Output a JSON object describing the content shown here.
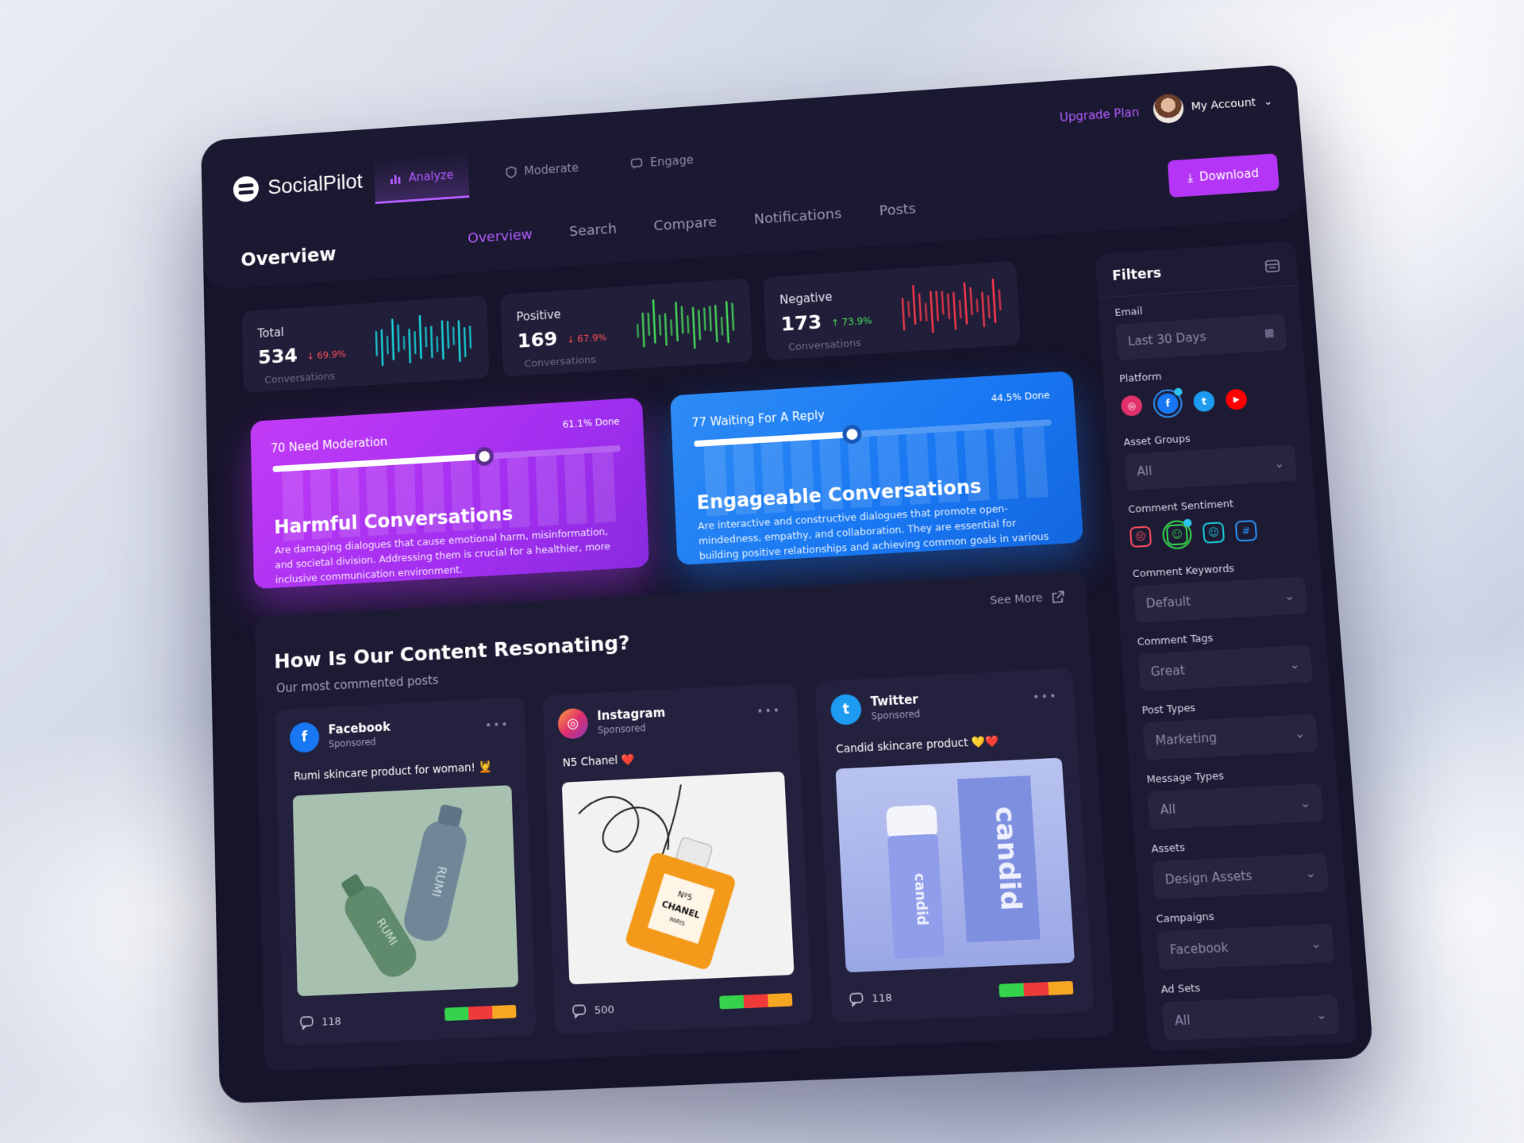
{
  "app": {
    "name": "SocialPilot"
  },
  "header": {
    "main_tabs": [
      {
        "label": "Analyze",
        "active": true
      },
      {
        "label": "Moderate",
        "active": false
      },
      {
        "label": "Engage",
        "active": false
      }
    ],
    "upgrade_label": "Upgrade Plan",
    "account_label": "My Account",
    "download_label": "Download"
  },
  "page": {
    "title": "Overview",
    "sub_tabs": [
      "Overview",
      "Search",
      "Compare",
      "Notifications",
      "Posts"
    ],
    "active_sub_tab": "Overview"
  },
  "stats": [
    {
      "label": "Total",
      "value": "534",
      "delta": "↓ 69.9%",
      "delta_color": "#ff4d5e",
      "sub": "Conversations",
      "spark_color": "#19e0e6"
    },
    {
      "label": "Positive",
      "value": "169",
      "delta": "↓ 67.9%",
      "delta_color": "#ff4d5e",
      "sub": "Conversations",
      "spark_color": "#48e05a"
    },
    {
      "label": "Negative",
      "value": "173",
      "delta": "↑ 73.9%",
      "delta_color": "#48e05a",
      "sub": "Conversations",
      "spark_color": "#ff3a4c"
    }
  ],
  "moderation": {
    "progress_label": "70 Need Moderation",
    "done_label": "61.1% Done",
    "progress": 0.611,
    "title": "Harmful Conversations",
    "description": "Are damaging dialogues that cause emotional harm, misinformation, and societal division. Addressing them is crucial for a healthier, more inclusive communication environment."
  },
  "engageable": {
    "progress_label": "77 Waiting For A Reply",
    "done_label": "44.5% Done",
    "progress": 0.445,
    "title": "Engageable Conversations",
    "description": "Are interactive and constructive dialogues that promote open-mindedness, empathy, and collaboration. They are essential for building positive relationships and achieving common goals in various contexts."
  },
  "content": {
    "title": "How Is Our Content Resonating?",
    "subtitle": "Our most commented posts",
    "see_more": "See More",
    "posts": [
      {
        "platform": "Facebook",
        "sponsored": "Sponsored",
        "caption": "Rumi skincare product for woman! 💆",
        "comments": "118",
        "color": "#1877f2",
        "glyph": "f"
      },
      {
        "platform": "Instagram",
        "sponsored": "Sponsored",
        "caption": "N5 Chanel ❤️",
        "comments": "500",
        "color": "#e1306c",
        "glyph": "◎"
      },
      {
        "platform": "Twitter",
        "sponsored": "Sponsored",
        "caption": "Candid skincare product 💛❤️",
        "comments": "118",
        "color": "#1d9bf0",
        "glyph": "t"
      }
    ],
    "image_text": {
      "rumi": "RUMI",
      "chanel_brand": "CHANEL",
      "chanel_no": "Nº5",
      "chanel_sub": "PARIS",
      "candid": "candid"
    },
    "sentiment_colors": [
      "#35d24b",
      "#ef3a3a",
      "#f5a623"
    ]
  },
  "filters": {
    "title": "Filters",
    "email": {
      "label": "Email",
      "value": "Last 30 Days"
    },
    "platform_label": "Platform",
    "platforms": [
      {
        "name": "instagram",
        "color": "#e1306c",
        "glyph": "◎"
      },
      {
        "name": "facebook",
        "color": "#1877f2",
        "glyph": "f",
        "selected": true
      },
      {
        "name": "twitter",
        "color": "#1d9bf0",
        "glyph": "t"
      },
      {
        "name": "youtube",
        "color": "#ff0000",
        "glyph": "▶"
      }
    ],
    "asset_groups": {
      "label": "Asset Groups",
      "value": "All"
    },
    "sentiment_label": "Comment Sentiment",
    "sentiments": [
      {
        "name": "negative",
        "color": "#ff4d5e",
        "glyph": "☹"
      },
      {
        "name": "positive",
        "color": "#35d24b",
        "glyph": "☺",
        "selected": true
      },
      {
        "name": "neutral",
        "color": "#19c9d9",
        "glyph": "☺"
      },
      {
        "name": "tag",
        "color": "#2b8ef0",
        "glyph": "#"
      }
    ],
    "keywords": {
      "label": "Comment Keywords",
      "value": "Default"
    },
    "tags": {
      "label": "Comment Tags",
      "value": "Great"
    },
    "post_types": {
      "label": "Post Types",
      "value": "Marketing"
    },
    "message_types": {
      "label": "Message Types",
      "value": "All"
    },
    "assets": {
      "label": "Assets",
      "value": "Design Assets"
    },
    "campaigns": {
      "label": "Campaigns",
      "value": "Facebook"
    },
    "ad_sets": {
      "label": "Ad Sets",
      "value": "All"
    }
  }
}
